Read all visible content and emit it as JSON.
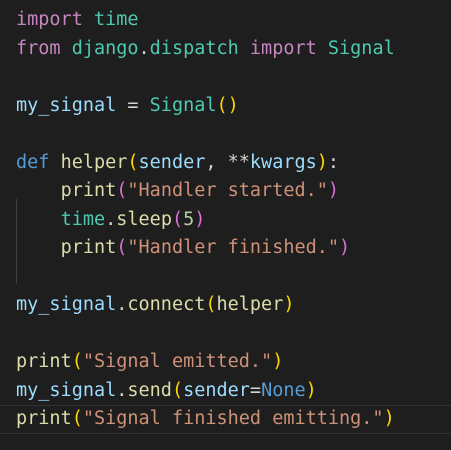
{
  "editor": {
    "lines": [
      {
        "tokens": [
          {
            "text": "import",
            "type": "keyword"
          },
          {
            "text": " ",
            "type": "plain"
          },
          {
            "text": "time",
            "type": "class"
          }
        ]
      },
      {
        "tokens": [
          {
            "text": "from",
            "type": "keyword"
          },
          {
            "text": " ",
            "type": "plain"
          },
          {
            "text": "django",
            "type": "class"
          },
          {
            "text": ".",
            "type": "plain"
          },
          {
            "text": "dispatch",
            "type": "class"
          },
          {
            "text": " ",
            "type": "plain"
          },
          {
            "text": "import",
            "type": "keyword"
          },
          {
            "text": " ",
            "type": "plain"
          },
          {
            "text": "Signal",
            "type": "class"
          }
        ]
      },
      {
        "tokens": []
      },
      {
        "tokens": [
          {
            "text": "my_signal",
            "type": "var"
          },
          {
            "text": " = ",
            "type": "plain"
          },
          {
            "text": "Signal",
            "type": "class"
          },
          {
            "text": "()",
            "type": "paren1"
          }
        ]
      },
      {
        "tokens": []
      },
      {
        "tokens": [
          {
            "text": "def",
            "type": "def"
          },
          {
            "text": " ",
            "type": "plain"
          },
          {
            "text": "helper",
            "type": "func"
          },
          {
            "text": "(",
            "type": "paren1"
          },
          {
            "text": "sender",
            "type": "param"
          },
          {
            "text": ", **",
            "type": "plain"
          },
          {
            "text": "kwargs",
            "type": "param"
          },
          {
            "text": ")",
            "type": "paren1"
          },
          {
            "text": ":",
            "type": "plain"
          }
        ]
      },
      {
        "tokens": [
          {
            "text": "    ",
            "type": "plain"
          },
          {
            "text": "print",
            "type": "func"
          },
          {
            "text": "(",
            "type": "paren2"
          },
          {
            "text": "\"Handler started.\"",
            "type": "string"
          },
          {
            "text": ")",
            "type": "paren2"
          }
        ]
      },
      {
        "tokens": [
          {
            "text": "    ",
            "type": "plain"
          },
          {
            "text": "time",
            "type": "class"
          },
          {
            "text": ".",
            "type": "plain"
          },
          {
            "text": "sleep",
            "type": "func"
          },
          {
            "text": "(",
            "type": "paren2"
          },
          {
            "text": "5",
            "type": "number"
          },
          {
            "text": ")",
            "type": "paren2"
          }
        ]
      },
      {
        "tokens": [
          {
            "text": "    ",
            "type": "plain"
          },
          {
            "text": "print",
            "type": "func"
          },
          {
            "text": "(",
            "type": "paren2"
          },
          {
            "text": "\"Handler finished.\"",
            "type": "string"
          },
          {
            "text": ")",
            "type": "paren2"
          }
        ]
      },
      {
        "tokens": []
      },
      {
        "tokens": [
          {
            "text": "my_signal",
            "type": "var"
          },
          {
            "text": ".",
            "type": "plain"
          },
          {
            "text": "connect",
            "type": "func"
          },
          {
            "text": "(",
            "type": "paren1"
          },
          {
            "text": "helper",
            "type": "func"
          },
          {
            "text": ")",
            "type": "paren1"
          }
        ]
      },
      {
        "tokens": []
      },
      {
        "tokens": [
          {
            "text": "print",
            "type": "func"
          },
          {
            "text": "(",
            "type": "paren1"
          },
          {
            "text": "\"Signal emitted.\"",
            "type": "string"
          },
          {
            "text": ")",
            "type": "paren1"
          }
        ]
      },
      {
        "tokens": [
          {
            "text": "my_signal",
            "type": "var"
          },
          {
            "text": ".",
            "type": "plain"
          },
          {
            "text": "send",
            "type": "func"
          },
          {
            "text": "(",
            "type": "paren1"
          },
          {
            "text": "sender",
            "type": "param"
          },
          {
            "text": "=",
            "type": "plain"
          },
          {
            "text": "None",
            "type": "const"
          },
          {
            "text": ")",
            "type": "paren1"
          }
        ]
      },
      {
        "tokens": [
          {
            "text": "print",
            "type": "func"
          },
          {
            "text": "(",
            "type": "paren1"
          },
          {
            "text": "\"Signal finished emitting.\"",
            "type": "string"
          },
          {
            "text": ")",
            "type": "paren1"
          }
        ],
        "current": true
      }
    ]
  }
}
